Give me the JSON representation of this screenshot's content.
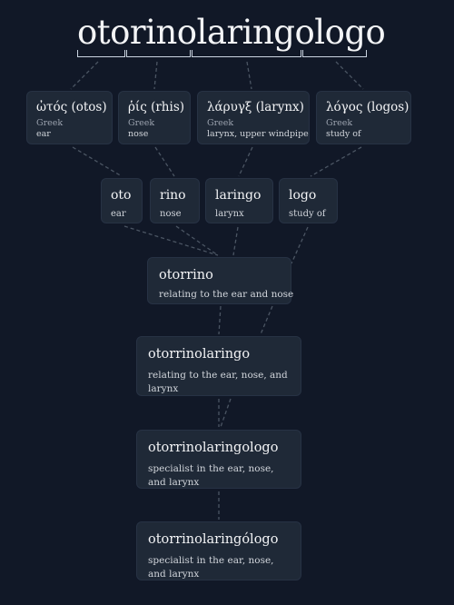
{
  "word": "otorinolaringologo",
  "segments": [
    "oto",
    "rino",
    "laringo",
    "logo"
  ],
  "roots": [
    {
      "term": "ὠτός (otos)",
      "language": "Greek",
      "meaning": "ear"
    },
    {
      "term": "ῥίς (rhis)",
      "language": "Greek",
      "meaning": "nose"
    },
    {
      "term": "λάρυγξ (larynx)",
      "language": "Greek",
      "meaning": "larynx, upper windpipe"
    },
    {
      "term": "λόγος (logos)",
      "language": "Greek",
      "meaning": "study of"
    }
  ],
  "morphemes": [
    {
      "form": "oto",
      "meaning": "ear"
    },
    {
      "form": "rino",
      "meaning": "nose"
    },
    {
      "form": "laringo",
      "meaning": "larynx"
    },
    {
      "form": "logo",
      "meaning": "study of"
    }
  ],
  "compounds": [
    {
      "form": "otorrino",
      "meaning": "relating to the ear and nose"
    },
    {
      "form": "otorrinolaringo",
      "meaning": "relating to the ear, nose, and larynx"
    },
    {
      "form": "otorrinolaringologo",
      "meaning": "specialist in the ear, nose, and larynx"
    },
    {
      "form": "otorrinolaringólogo",
      "meaning": "specialist in the ear, nose, and larynx"
    }
  ],
  "colors": {
    "background": "#111827",
    "card": "#1f2937",
    "link": "#4b5563"
  }
}
